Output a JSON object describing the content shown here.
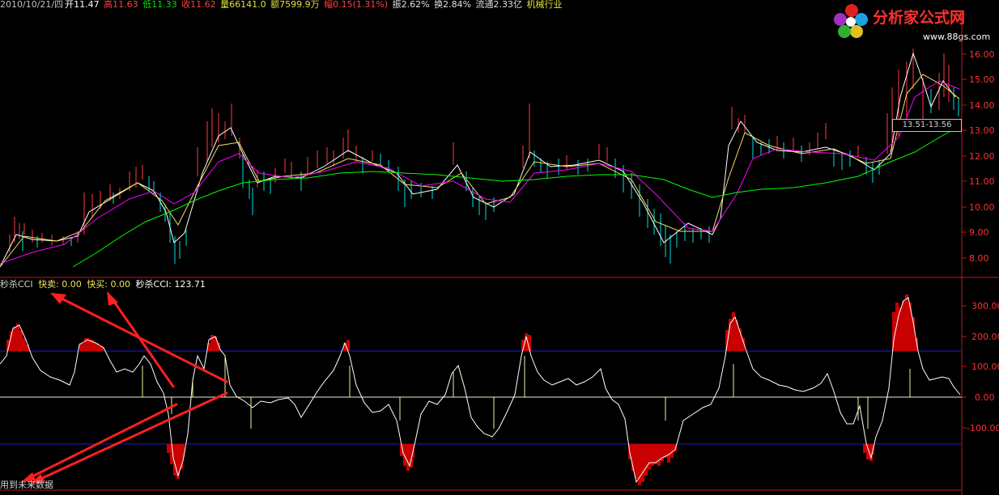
{
  "info_bar": {
    "date": "2010/10/21/四",
    "open": "开11.47",
    "high": "高11.63",
    "low": "低11.33",
    "close": "收11.62",
    "volume": "量66141.0",
    "amount": "额7599.9万",
    "change": "幅0.15(1.31%)",
    "amplitude": "振2.62%",
    "turnover": "换2.84%",
    "float": "流通2.33亿",
    "industry": "机械行业"
  },
  "logo": {
    "name": "分析家公式网",
    "url": "www.88gs.com"
  },
  "price_panel": {
    "y_ticks": [
      "16.00",
      "15.00",
      "14.00",
      "13.00",
      "12.00",
      "11.00",
      "10.00",
      "9.00",
      "8.00"
    ],
    "range_label": "13.51-13.56"
  },
  "cci_panel": {
    "legend": {
      "name": "秒杀CCI",
      "fast_sell": "快卖: 0.00",
      "fast_buy": "快买: 0.00",
      "cci_value": "秒杀CCI: 123.71"
    },
    "y_ticks": [
      "300.00",
      "200.00",
      "100.00",
      "0.00",
      "-100.00"
    ],
    "annotation": "用到未来数据"
  },
  "colors": {
    "background": "#000000",
    "axis_red": "#c01818",
    "up_candle": "#ff3c3c",
    "down_candle": "#00e0e0",
    "ma_short": "#ffffff",
    "ma_mid": "#f0e060",
    "ma_purple": "#ff00ff",
    "ma_long": "#00ff00",
    "threshold_line": "#1e1ec8",
    "zero_line": "#f0f0c8",
    "cci_fill": "#c80000",
    "arrow": "#ff2020"
  }
}
